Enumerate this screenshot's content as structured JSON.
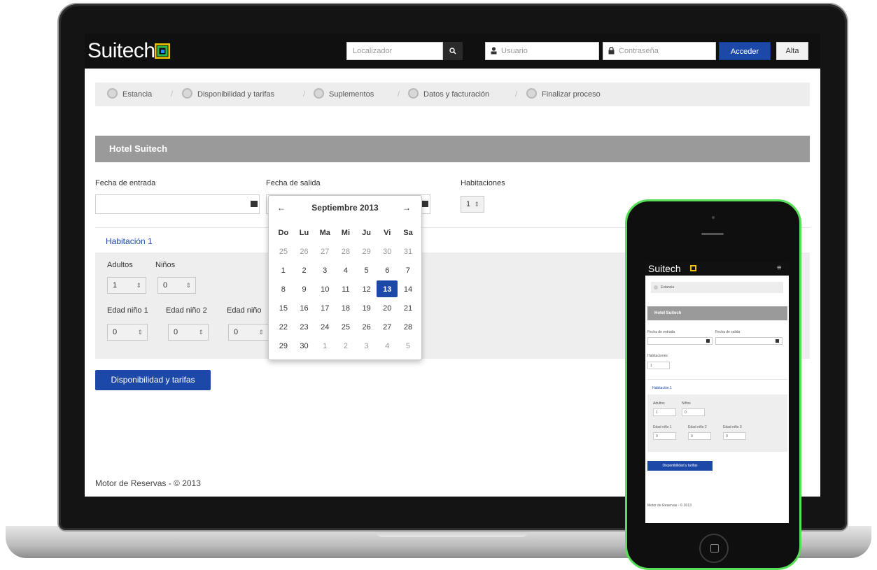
{
  "laptop": {
    "brand": "Suitech",
    "header": {
      "locator_placeholder": "Localizador",
      "search_glyph": "🔍",
      "user_placeholder": "Usuario",
      "password_placeholder": "Contraseña",
      "login_label": "Acceder",
      "signup_label": "Alta"
    },
    "steps": [
      "Estancia",
      "Disponibilidad y tarifas",
      "Suplementos",
      "Datos y facturación",
      "Finalizar proceso"
    ],
    "step_separator": "/",
    "hotel_name": "Hotel Suitech",
    "checkin_label": "Fecha de entrada",
    "checkout_label": "Fecha de salida",
    "rooms_label": "Habitaciones",
    "rooms_value": "1",
    "room_title": "Habitación 1",
    "adults_label": "Adultos",
    "adults_value": "1",
    "children_label": "Niños",
    "children_value": "0",
    "child_age_labels": [
      "Edad niño 1",
      "Edad niño 2",
      "Edad niño"
    ],
    "child_age_values": [
      "0",
      "0",
      "0"
    ],
    "search_button": "Disponibilidad y tarifas",
    "footer": "Motor de Reservas - © 2013",
    "datepicker": {
      "prev": "←",
      "next": "→",
      "month": "Septiembre 2013",
      "weekdays": [
        "Do",
        "Lu",
        "Ma",
        "Mi",
        "Ju",
        "Vi",
        "Sa"
      ],
      "weeks": [
        [
          "25",
          "26",
          "27",
          "28",
          "29",
          "30",
          "31"
        ],
        [
          "1",
          "2",
          "3",
          "4",
          "5",
          "6",
          "7"
        ],
        [
          "8",
          "9",
          "10",
          "11",
          "12",
          "13",
          "14"
        ],
        [
          "15",
          "16",
          "17",
          "18",
          "19",
          "20",
          "21"
        ],
        [
          "22",
          "23",
          "24",
          "25",
          "26",
          "27",
          "28"
        ],
        [
          "29",
          "30",
          "1",
          "2",
          "3",
          "4",
          "5"
        ]
      ],
      "selected_day": "13"
    }
  },
  "phone": {
    "brand": "Suitech",
    "step": "Estancia",
    "hotel_name": "Hotel Suitech",
    "checkin_label": "Fecha de entrada",
    "checkout_label": "Fecha de salida",
    "rooms_label": "Habitaciones",
    "rooms_value": "1",
    "room_title": "Habitación 1",
    "adults_label": "Adultos",
    "children_label": "Niños",
    "adults_value": "1",
    "children_value": "0",
    "child_age_labels": [
      "Edad niño 1",
      "Edad niño 2",
      "Edad niño 3"
    ],
    "child_age_values": [
      "0",
      "0",
      "0"
    ],
    "search_button": "Disponibilidad y tarifas",
    "footer": "Motor de Reservas - © 2013",
    "menu_glyph": "≡"
  },
  "colors": {
    "accent": "#1c49a8",
    "topbar": "#101010",
    "hotel_bar": "#9a9a9a",
    "phone_glow": "#56e056"
  }
}
